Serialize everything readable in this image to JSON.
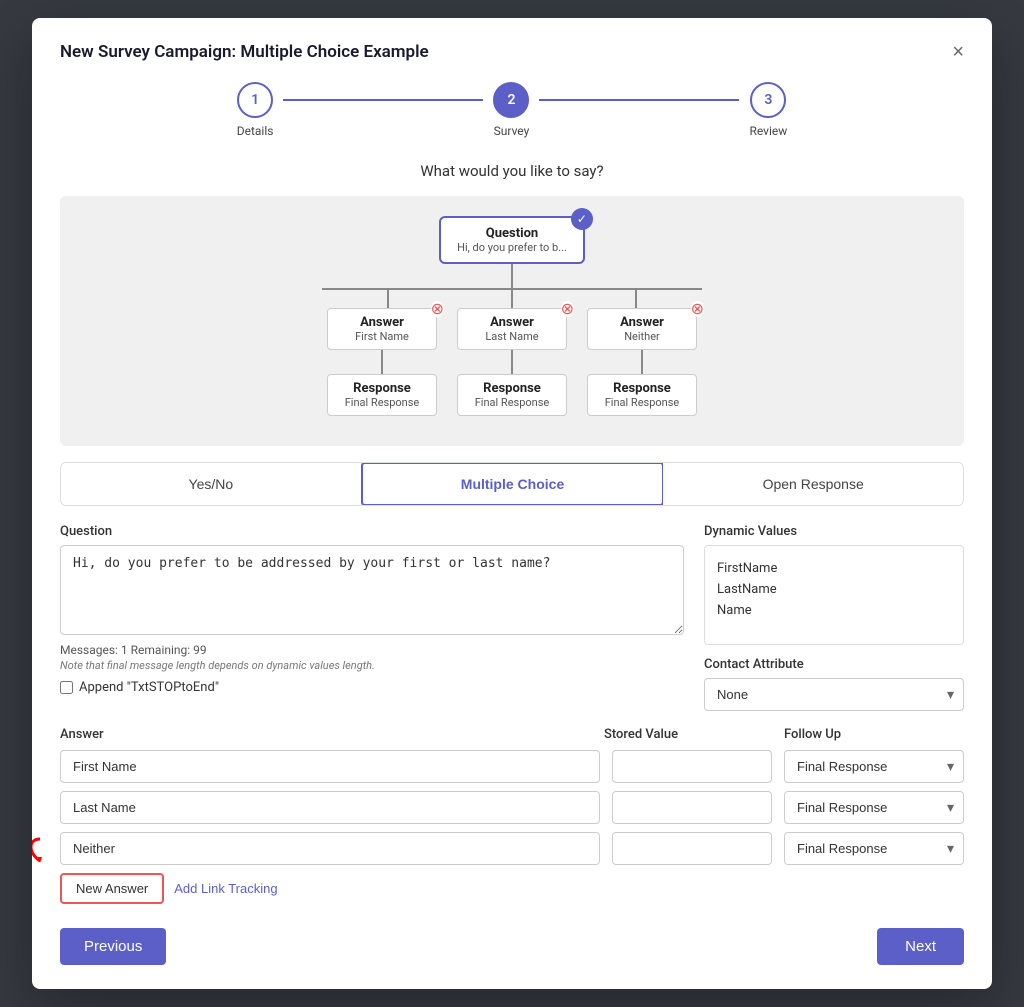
{
  "modal": {
    "title": "New Survey Campaign: Multiple Choice Example",
    "close_label": "×"
  },
  "stepper": {
    "steps": [
      {
        "number": "1",
        "label": "Details",
        "active": false
      },
      {
        "number": "2",
        "label": "Survey",
        "active": true
      },
      {
        "number": "3",
        "label": "Review",
        "active": false
      }
    ]
  },
  "flow": {
    "section_title": "What would you like to say?",
    "question_node": {
      "title": "Question",
      "subtitle": "Hi, do you prefer to b..."
    },
    "answer_nodes": [
      {
        "title": "Answer",
        "subtitle": "First Name"
      },
      {
        "title": "Answer",
        "subtitle": "Last Name"
      },
      {
        "title": "Answer",
        "subtitle": "Neither"
      }
    ],
    "response_nodes": [
      {
        "title": "Response",
        "subtitle": "Final Response"
      },
      {
        "title": "Response",
        "subtitle": "Final Response"
      },
      {
        "title": "Response",
        "subtitle": "Final Response"
      }
    ]
  },
  "tabs": [
    {
      "label": "Yes/No",
      "active": false
    },
    {
      "label": "Multiple Choice",
      "active": true
    },
    {
      "label": "Open Response",
      "active": false
    }
  ],
  "question_field": {
    "label": "Question",
    "value": "Hi, do you prefer to be addressed by your first or last name?",
    "messages_info": "Messages: 1  Remaining: 99",
    "note": "Note that final message length depends on dynamic values length.",
    "append_label": "Append \"TxtSTOPtoEnd\""
  },
  "dynamic_values": {
    "label": "Dynamic Values",
    "items": [
      "FirstName",
      "LastName",
      "Name"
    ],
    "contact_attr_label": "Contact Attribute",
    "contact_attr_value": "None"
  },
  "answers_table": {
    "col_answer": "Answer",
    "col_stored": "Stored Value",
    "col_followup": "Follow Up",
    "rows": [
      {
        "answer": "First Name",
        "stored": "",
        "followup": "Final Response"
      },
      {
        "answer": "Last Name",
        "stored": "",
        "followup": "Final Response"
      },
      {
        "answer": "Neither",
        "stored": "",
        "followup": "Final Response"
      }
    ]
  },
  "action_buttons": {
    "new_answer": "New Answer",
    "add_link": "Add Link Tracking"
  },
  "footer": {
    "previous": "Previous",
    "next": "Next"
  }
}
